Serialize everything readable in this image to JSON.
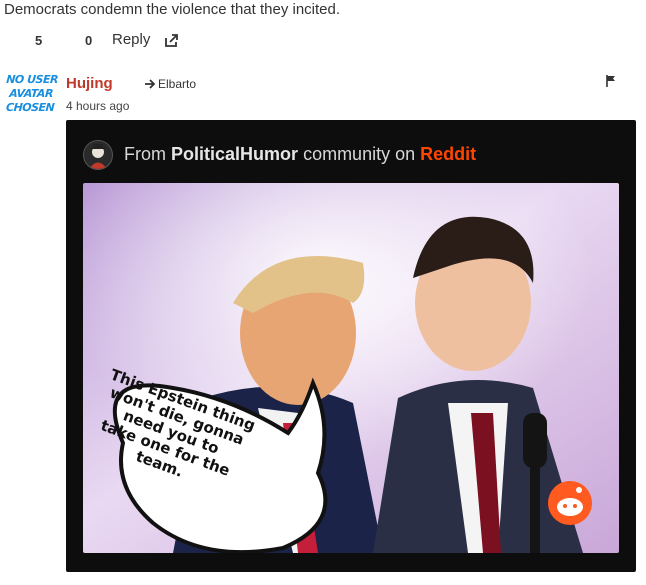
{
  "comment_above": {
    "text": "Democrats condemn the violence that they incited.",
    "upvotes": "5",
    "downvotes": "0",
    "reply_label": "Reply"
  },
  "reply_comment": {
    "avatar_lines": [
      "NO USER",
      "AVATAR",
      "CHOSEN"
    ],
    "username": "Hujing",
    "reply_to": "Elbarto",
    "timestamp": "4 hours ago",
    "embed": {
      "prefix": "From",
      "community": "PoliticalHumor",
      "middle": "community on",
      "platform": "Reddit",
      "meme_lines": [
        "This Epstein thing",
        "won't die, gonna",
        "need you to",
        "take one for the",
        "team."
      ]
    }
  },
  "colors": {
    "username": "#c0392b",
    "avatar_text": "#1a8fe0",
    "reddit_orange": "#ff4500",
    "embed_bg": "#0d0d0d"
  }
}
